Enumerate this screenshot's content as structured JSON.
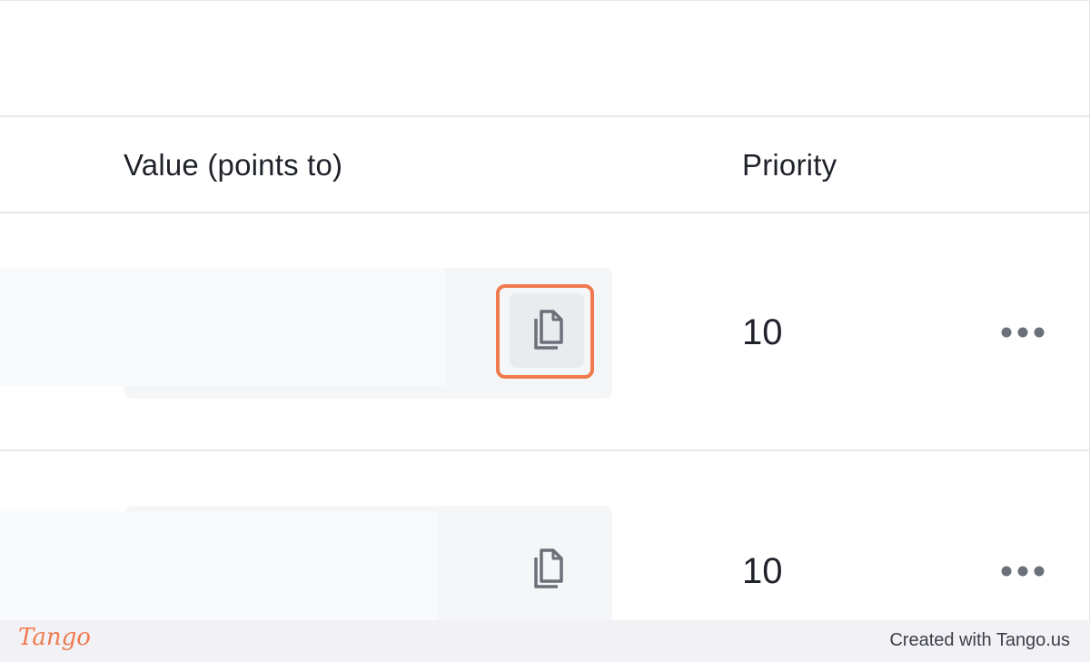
{
  "table": {
    "columns": {
      "value": "Value (points to)",
      "priority": "Priority"
    },
    "rows": [
      {
        "value": "",
        "priority": "10"
      },
      {
        "value": "",
        "priority": "10"
      }
    ]
  },
  "icons": {
    "copy": "copy-icon",
    "more": "more-horizontal-icon"
  },
  "colors": {
    "highlight": "#ef7b4e",
    "field_bg": "#f4f6f8",
    "icon": "#6b7079"
  },
  "footer": {
    "logo": "Tango",
    "credit": "Created with Tango.us"
  }
}
